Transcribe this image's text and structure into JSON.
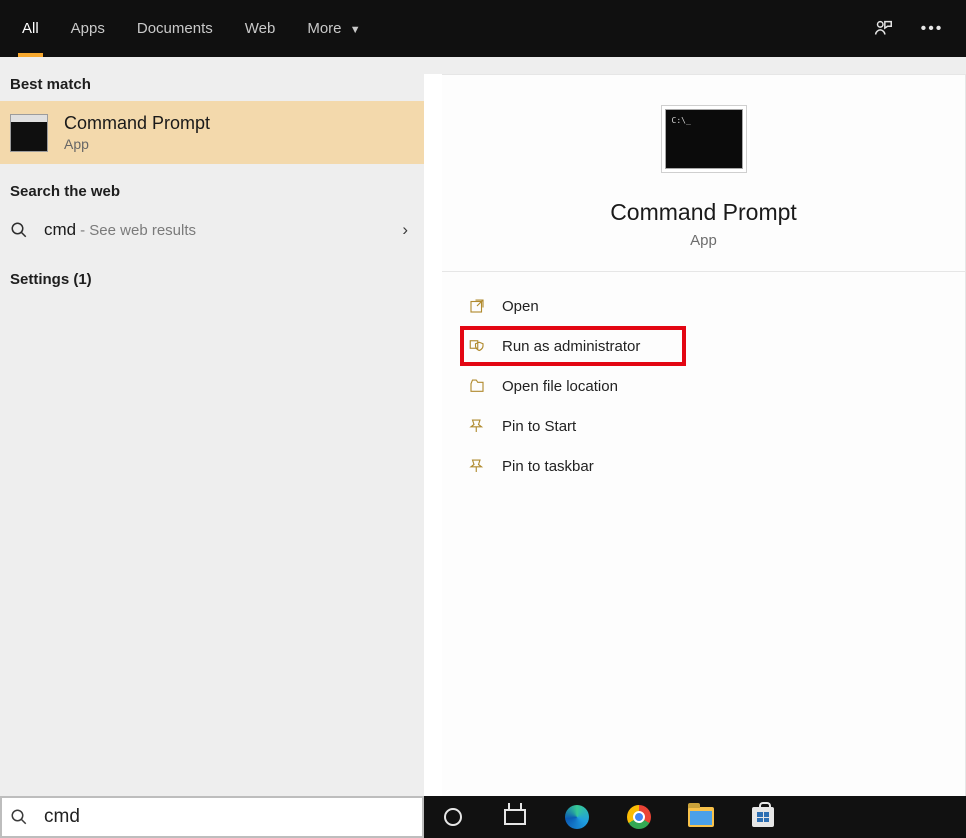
{
  "tabs": {
    "all": "All",
    "apps": "Apps",
    "documents": "Documents",
    "web": "Web",
    "more": "More"
  },
  "left": {
    "best_match_header": "Best match",
    "best_match": {
      "title": "Command Prompt",
      "subtitle": "App"
    },
    "web_header": "Search the web",
    "web": {
      "query": "cmd",
      "hint": "- See web results"
    },
    "settings_header": "Settings (1)"
  },
  "detail": {
    "title": "Command Prompt",
    "subtitle": "App",
    "actions": {
      "open": "Open",
      "run_admin": "Run as administrator",
      "open_location": "Open file location",
      "pin_start": "Pin to Start",
      "pin_taskbar": "Pin to taskbar"
    }
  },
  "search": {
    "value": "cmd"
  }
}
